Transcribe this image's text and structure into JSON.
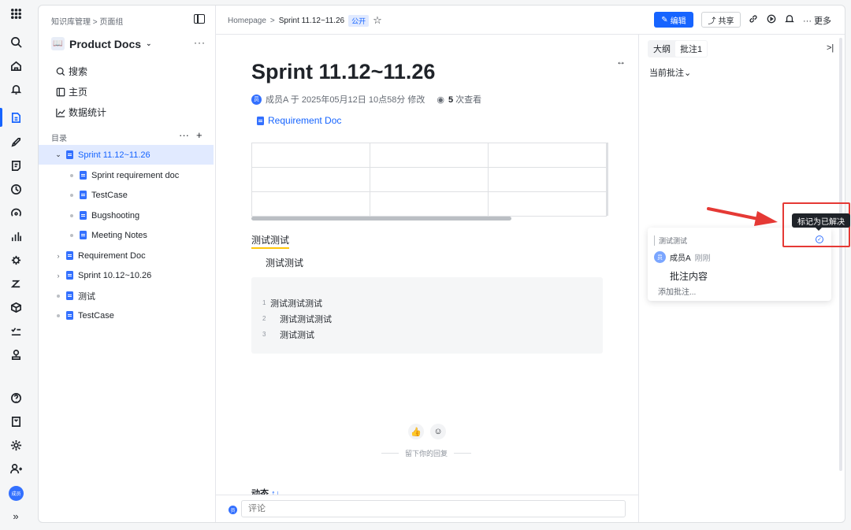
{
  "rail": {
    "icons": [
      "apps-grid-icon",
      "search-icon",
      "home-icon",
      "bell-icon",
      "docs-icon",
      "rocket-icon",
      "notes-icon",
      "clock-icon",
      "gauge-icon",
      "bar-chart-icon",
      "bug-icon",
      "sort-icon",
      "cube-icon",
      "checklist-icon",
      "stamp-icon",
      "help-icon",
      "inbox-icon",
      "gear-icon",
      "add-user-icon",
      "user-avatar",
      "expand-icon"
    ],
    "avatar_text": "成员",
    "expand": "»"
  },
  "sidebar": {
    "breadcrumb": "知识库管理 > 页面组",
    "space_icon": "📖",
    "space_name": "Product Docs",
    "space_chevron": "⌄",
    "more": "···",
    "nav": [
      {
        "label": "搜索",
        "icon": "search-icon"
      },
      {
        "label": "主页",
        "icon": "homepage-icon"
      },
      {
        "label": "数据统计",
        "icon": "line-chart-icon"
      }
    ],
    "toc_label": "目录",
    "toc_more": "···",
    "toc_add": "+",
    "tree": [
      {
        "label": "Sprint 11.12~11.26",
        "kind": "arrow",
        "arrow": "⌄",
        "depth": 0,
        "selected": true
      },
      {
        "label": "Sprint requirement doc",
        "kind": "dot",
        "depth": 1
      },
      {
        "label": "TestCase",
        "kind": "dot",
        "depth": 1
      },
      {
        "label": "Bugshooting",
        "kind": "dot",
        "depth": 1
      },
      {
        "label": "Meeting Notes",
        "kind": "dot",
        "depth": 1
      },
      {
        "label": "Requirement Doc",
        "kind": "arrow",
        "arrow": "›",
        "depth": 0
      },
      {
        "label": "Sprint 10.12~10.26",
        "kind": "arrow",
        "arrow": "›",
        "depth": 0
      },
      {
        "label": "测试",
        "kind": "dot",
        "depth": 0
      },
      {
        "label": "TestCase",
        "kind": "dot",
        "depth": 0
      }
    ]
  },
  "topbar": {
    "crumb_home": "Homepage",
    "crumb_sep": ">",
    "crumb_current": "Sprint 11.12~11.26",
    "public_badge": "公开",
    "star": "☆",
    "edit": "编辑",
    "share": "共享",
    "more": "··· 更多"
  },
  "doc": {
    "expand": "↔",
    "title": "Sprint 11.12~11.26",
    "author_avatar": "员",
    "author_line": "成员A 于 2025年05月12日 10点58分 修改",
    "views_count": "5",
    "views_label": "次查看",
    "link": "Requirement Doc",
    "heading": "测试测试",
    "paragraph": "测试测试",
    "code_lines": [
      {
        "num": "1",
        "text": "测试测试测试"
      },
      {
        "num": "2",
        "text": "测试测试测试"
      },
      {
        "num": "3",
        "text": "测试测试"
      }
    ],
    "reply_label": "留下你的回复",
    "activity": "动态",
    "activity_sort": "↑↓",
    "comment_placeholder": "评论"
  },
  "rpanel": {
    "tab_outline": "大纲",
    "tab_comments": "批注1",
    "collapse": ">|",
    "current_comments": "当前批注⌄",
    "card": {
      "quote": "测试测试",
      "avatar": "员",
      "author": "成员A",
      "time": "刚刚",
      "body": "批注内容",
      "add": "添加批注..."
    },
    "tooltip": "标记为已解决"
  },
  "colors": {
    "accent": "#1664ff",
    "annotation_red": "#e53935",
    "highlight_yellow": "#ffc60a"
  }
}
